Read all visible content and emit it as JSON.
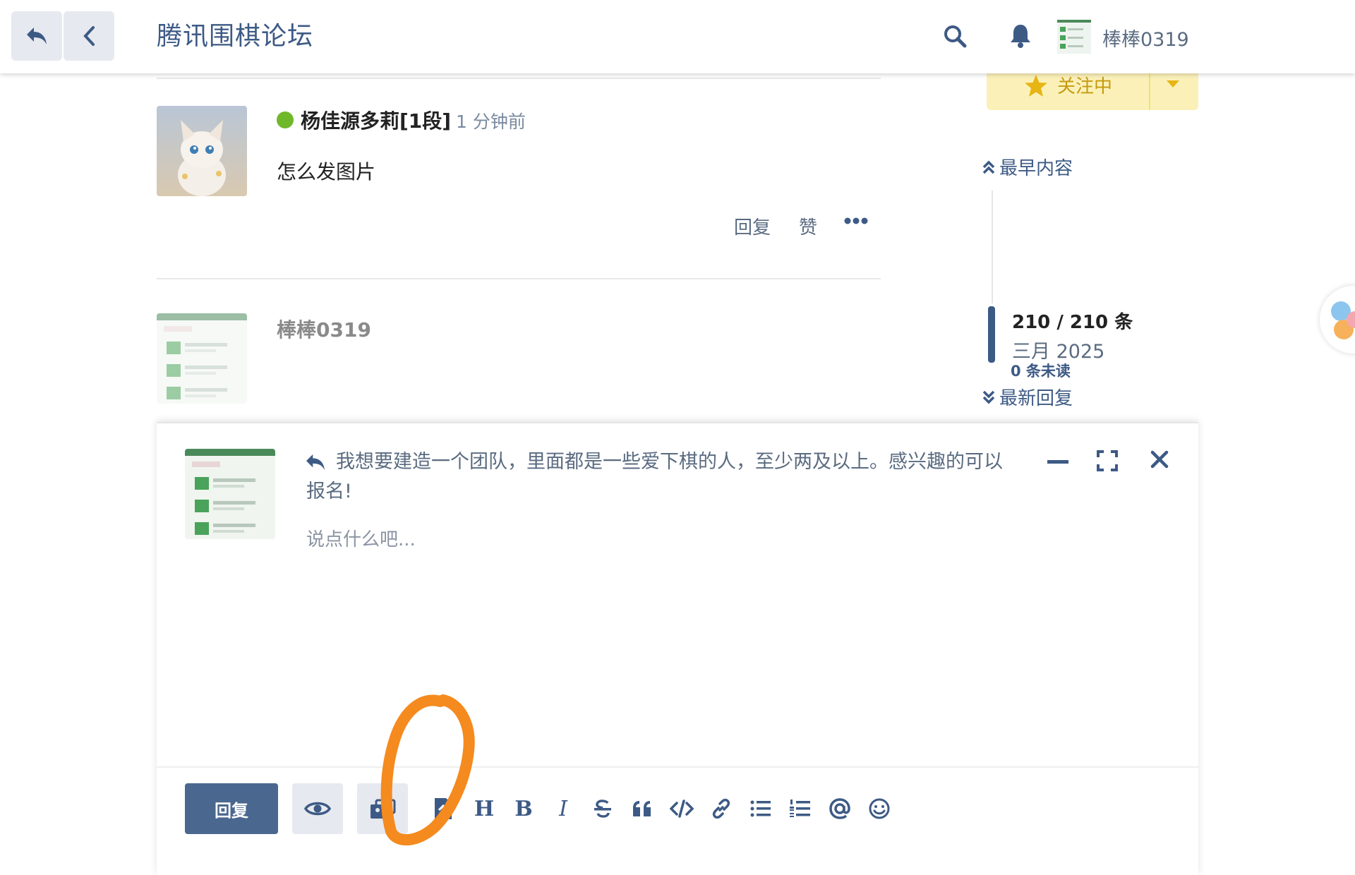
{
  "header": {
    "title": "腾讯围棋论坛",
    "username": "棒棒0319",
    "icons": [
      "reply-back-icon",
      "chevron-left-icon",
      "search-icon",
      "bell-icon"
    ]
  },
  "posts": [
    {
      "author": "杨佳源多莉[1段]",
      "time": "1 分钟前",
      "body": "怎么发图片",
      "actions": {
        "reply": "回复",
        "like": "赞"
      }
    }
  ],
  "draft": {
    "author": "棒棒0319"
  },
  "timeline": {
    "follow_label": "关注中",
    "earliest": "最早内容",
    "count": "210 / 210 条",
    "date": "三月 2025",
    "unread": "0 条未读",
    "latest": "最新回复"
  },
  "composer": {
    "quote": "我想要建造一个团队，里面都是一些爱下棋的人，至少两及以上。感兴趣的可以报名!",
    "placeholder": "说点什么吧...",
    "submit_label": "回复",
    "toolbar": [
      "preview-eye-icon",
      "image-upload-icon",
      "file-upload-icon",
      "heading-icon",
      "bold-icon",
      "italic-icon",
      "strikethrough-icon",
      "quote-icon",
      "code-icon",
      "link-icon",
      "bullet-list-icon",
      "numbered-list-icon",
      "mention-icon",
      "emoji-icon"
    ]
  },
  "colors": {
    "accent": "#3d5a85",
    "submit": "#4a6790",
    "follow_bg": "#fbf1b8",
    "online": "#6fb82a",
    "marker": "#f58a1f"
  }
}
